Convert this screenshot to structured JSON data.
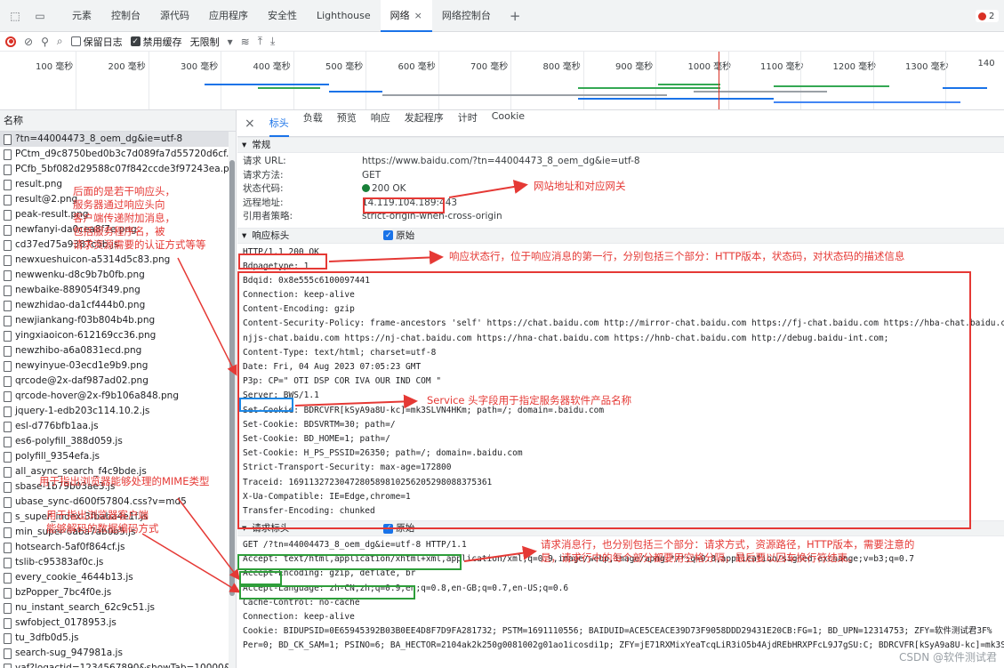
{
  "tabs": [
    {
      "label": "元素"
    },
    {
      "label": "控制台"
    },
    {
      "label": "源代码"
    },
    {
      "label": "应用程序"
    },
    {
      "label": "安全性"
    },
    {
      "label": "Lighthouse"
    },
    {
      "label": "网络",
      "active": true
    },
    {
      "label": "网络控制台"
    }
  ],
  "tab_close": "×",
  "tab_plus": "+",
  "error_count": "2",
  "toolbar": {
    "preserve_log": "保留日志",
    "disable_cache": "禁用缓存",
    "throttle": "无限制"
  },
  "timeline": {
    "ticks": [
      "100 毫秒",
      "200 毫秒",
      "300 毫秒",
      "400 毫秒",
      "500 毫秒",
      "600 毫秒",
      "700 毫秒",
      "800 毫秒",
      "900 毫秒",
      "1000 毫秒",
      "1100 毫秒",
      "1200 毫秒",
      "1300 毫秒",
      "140"
    ]
  },
  "request_list": {
    "header": "名称",
    "items": [
      "?tn=44004473_8_oem_dg&ie=utf-8",
      "PCtm_d9c8750bed0b3c7d089fa7d55720d6cf.png",
      "PCfb_5bf082d29588c07f842ccde3f97243ea.png",
      "result.png",
      "result@2.png",
      "peak-result.png",
      "newfanyi-da0cea8f7e.png",
      "cd37ed75a9387c5b.js",
      "newxueshuicon-a5314d5c83.png",
      "newwenku-d8c9b7b0fb.png",
      "newbaike-889054f349.png",
      "newzhidao-da1cf444b0.png",
      "newjiankang-f03b804b4b.png",
      "yingxiaoicon-612169cc36.png",
      "newzhibo-a6a0831ecd.png",
      "newyinyue-03ecd1e9b9.png",
      "qrcode@2x-daf987ad02.png",
      "qrcode-hover@2x-f9b106a848.png",
      "jquery-1-edb203c114.10.2.js",
      "esl-d776bfb1aa.js",
      "es6-polyfill_388d059.js",
      "polyfill_9354efa.js",
      "all_async_search_f4c9bde.js",
      "sbase-1b79b03ae3.js",
      "ubase_sync-d600f57804.css?v=md5",
      "s_super_index-3fbaba4e1f.js",
      "min_super-6aba7ab0b5.js",
      "hotsearch-5af0f864cf.js",
      "tslib-c95383af0c.js",
      "every_cookie_4644b13.js",
      "bzPopper_7bc4f0e.js",
      "nu_instant_search_62c9c51.js",
      "swfobject_0178953.js",
      "tu_3dfb0d5.js",
      "search-sug_947981a.js",
      "yaf?logactid=1234567890&showTab=10000&opType="
    ]
  },
  "detail": {
    "close": "×",
    "tabs": [
      "标头",
      "负载",
      "预览",
      "响应",
      "发起程序",
      "计时",
      "Cookie"
    ],
    "general": {
      "title": "常规",
      "rows": [
        {
          "k": "请求 URL:",
          "v": "https://www.baidu.com/?tn=44004473_8_oem_dg&ie=utf-8"
        },
        {
          "k": "请求方法:",
          "v": "GET"
        },
        {
          "k": "状态代码:",
          "v": "200 OK"
        },
        {
          "k": "远程地址:",
          "v": "14.119.104.189:443"
        },
        {
          "k": "引用者策略:",
          "v": "strict-origin-when-cross-origin"
        }
      ]
    },
    "response": {
      "title": "响应标头",
      "raw": "原始",
      "status_line": "HTTP/1.1 200 OK",
      "lines": [
        "Bdpagetype: 1",
        "Bdqid: 0x8e555c6100097441",
        "Connection: keep-alive",
        "Content-Encoding: gzip",
        "Content-Security-Policy: frame-ancestors 'self' https://chat.baidu.com http://mirror-chat.baidu.com https://fj-chat.baidu.com https://hba-chat.baidu.com https",
        "njjs-chat.baidu.com https://nj-chat.baidu.com https://hna-chat.baidu.com https://hnb-chat.baidu.com http://debug.baidu-int.com;",
        "Content-Type: text/html; charset=utf-8",
        "Date: Fri, 04 Aug 2023 07:05:23 GMT",
        "P3p: CP=\" OTI DSP COR IVA OUR IND COM \"",
        "Server: BWS/1.1",
        "Set-Cookie: BDRCVFR[kSyA9a8U-kc]=mk3SLVN4HKm; path=/; domain=.baidu.com",
        "Set-Cookie: BDSVRTM=30; path=/",
        "Set-Cookie: BD_HOME=1; path=/",
        "Set-Cookie: H_PS_PSSID=26350; path=/; domain=.baidu.com",
        "Strict-Transport-Security: max-age=172800",
        "Traceid: 1691132723047280589810256205298088375361",
        "X-Ua-Compatible: IE=Edge,chrome=1",
        "Transfer-Encoding: chunked"
      ]
    },
    "request": {
      "title": "请求标头",
      "raw": "原始",
      "request_line": "GET /?tn=44004473_8_oem_dg&ie=utf-8 HTTP/1.1",
      "lines": [
        "Accept: text/html,application/xhtml+xml,application/xml;q=0.9,image/webp,image/apng,*/*;q=0.8,application/signed-exchange;v=b3;q=0.7",
        "Accept-Encoding: gzip, deflate, br",
        "Accept-Language: zh-CN,zh;q=0.9,en;q=0.8,en-GB;q=0.7,en-US;q=0.6",
        "Cache-Control: no-cache",
        "Connection: keep-alive",
        "Cookie: BIDUPSID=0E65945392B03B0EE4D8F7D9FA281732; PSTM=1691110556; BAIDUID=ACE5CEACE39D73F9058DDD29431E20CB:FG=1; BD_UPN=12314753; ZFY=软件测试君3F%",
        "Per=0; BD_CK_SAM=1; PSINO=6; BA_HECTOR=2104ak2k250g0081002g01ao1icosdi1p; ZFY=jE71RXMixYeaTcqLiR3iO5b4AjdREbHRXPFcL9J7gSU:C; BDRCVFR[kSyA9a8U-kc]=mk3SLVN4HKm;"
      ]
    }
  },
  "annotations": {
    "url_note": "网站地址和对应网关",
    "status_line_note": "响应状态行，位于响应消息的第一行，分别包括三个部分：HTTP版本，状态码，对状态码的描述信息",
    "headers_note": [
      "后面的是若干响应头，",
      "服务器通过响应头向",
      "客户端传递附加消息，",
      "包括服务程序名，被",
      "请求资源需要的认证方式等等"
    ],
    "server_note": "Service 头字段用于指定服务器软件产品名称",
    "mime_note": "用于指出浏览器能够处理的MIME类型",
    "encoding_note": [
      "用于指出浏览器客户端",
      "能够解码的数据编码方式"
    ],
    "request_note": [
      "请求消息行，也分别包括三个部分：请求方式，资源路径，HTTP版本，需要注意的",
      "是，请求行中的每个部分都要用空格分隔，最后要以回车换行符结束。"
    ]
  },
  "watermark": "CSDN @软件测试君",
  "colors": {
    "red": "#e53935",
    "blue": "#1e88e5",
    "green": "#2e9e3a"
  }
}
